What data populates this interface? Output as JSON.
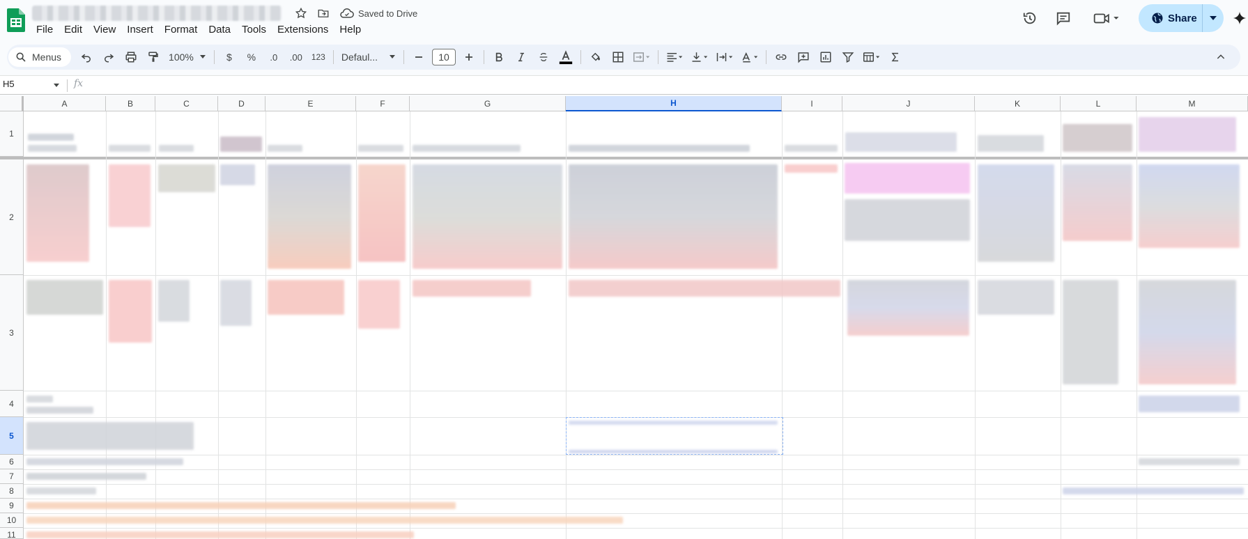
{
  "app": {
    "save_status": "Saved to Drive",
    "share_label": "Share"
  },
  "menu": [
    "File",
    "Edit",
    "View",
    "Insert",
    "Format",
    "Data",
    "Tools",
    "Extensions",
    "Help"
  ],
  "toolbar": {
    "search_label": "Menus",
    "zoom": "100%",
    "currency": "$",
    "percent": "%",
    "decrease_decimal": ".0",
    "increase_decimal": ".00",
    "number_format": "123",
    "font_family": "Defaul...",
    "font_size": "10"
  },
  "formula_bar": {
    "cell_ref": "H5",
    "fx": "fx",
    "value": ""
  },
  "sheet": {
    "columns": [
      "A",
      "B",
      "C",
      "D",
      "E",
      "F",
      "G",
      "H",
      "I",
      "J",
      "K",
      "L",
      "M"
    ],
    "selected_column": "H",
    "rows": [
      "1",
      "2",
      "3",
      "4",
      "5",
      "6",
      "7",
      "8",
      "9",
      "10",
      "11"
    ],
    "selected_row": "5"
  },
  "colors": {
    "accent": "#0b57d0",
    "share_bg": "#c2e7ff",
    "toolbar_bg": "#edf2fa",
    "sheets_green": "#0f9d58"
  }
}
